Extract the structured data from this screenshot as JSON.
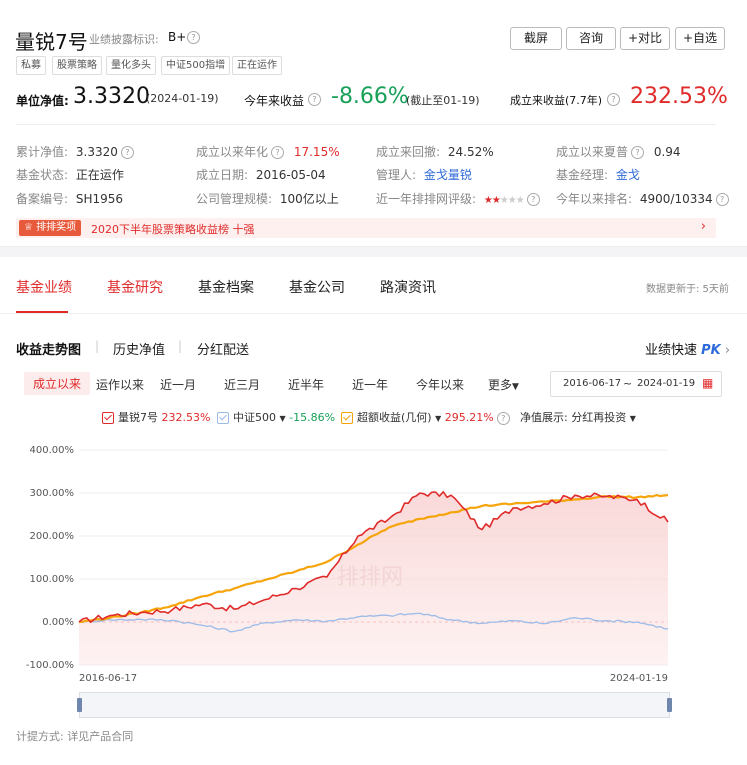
{
  "header": {
    "fund_name": "量锐7号",
    "disclosure_label": "业绩披露标识:",
    "disclosure_value": "B+",
    "tags": [
      "私募",
      "股票策略",
      "量化多头",
      "中证500指增",
      "正在运作"
    ],
    "buttons": [
      "截屏",
      "咨询",
      "+对比",
      "+自选"
    ]
  },
  "metrics": {
    "nav_label": "单位净值:",
    "nav_value": "3.3320",
    "nav_date": "(2024-01-19)",
    "ytd_label": "今年来收益",
    "ytd_value": "-8.66%",
    "ytd_note": "(截止至01-19)",
    "since_label": "成立来收益(7.7年)",
    "since_value": "232.53%"
  },
  "details": [
    {
      "label": "累计净值:",
      "value": "3.3320",
      "q": true
    },
    {
      "label": "成立以来年化",
      "value": "17.15%",
      "q": true
    },
    {
      "label": "成立来回撤:",
      "value": "24.52%"
    },
    {
      "label": "成立以来夏普",
      "value": "0.94",
      "q": true
    },
    {
      "label": "基金状态:",
      "value": "正在运作"
    },
    {
      "label": "成立日期:",
      "value": "2016-05-04"
    },
    {
      "label": "管理人:",
      "value": "金戈量锐"
    },
    {
      "label": "基金经理:",
      "value": "金戈"
    },
    {
      "label": "备案编号:",
      "value": "SH1956"
    },
    {
      "label": "公司管理规模:",
      "value": "100亿以上"
    },
    {
      "label": "近一年排排网评级:",
      "value": ""
    },
    {
      "label": "今年以来排名:",
      "value": "4900/10334",
      "q": true
    }
  ],
  "banner": {
    "badge": "排排奖项",
    "text": "2020下半年股票策略收益榜 十强"
  },
  "nav_tabs": [
    "基金业绩",
    "基金研究",
    "基金档案",
    "基金公司",
    "路演资讯"
  ],
  "update_note": "数据更新于:  5天前",
  "sub_tabs": [
    "收益走势图",
    "历史净值",
    "分红配送"
  ],
  "quick_perf": "业绩快速",
  "pk": "PK",
  "ranges": [
    "成立以来",
    "运作以来",
    "近一月",
    "近三月",
    "近半年",
    "近一年",
    "今年以来",
    "更多"
  ],
  "date_range": {
    "start": "2016-06-17",
    "sep": "~",
    "end": "2024-01-19"
  },
  "legend": {
    "fund": {
      "name": "量锐7号",
      "value": "232.53%",
      "color": "#e02b2b"
    },
    "index": {
      "name": "中证500",
      "value": "-15.86%",
      "color": "#9bbbe8"
    },
    "excess": {
      "name": "超额收益(几何)",
      "value": "295.21%",
      "color": "#f5a40a"
    },
    "display_label": "净值展示:",
    "display_value": "分红再投资"
  },
  "footer": {
    "label": "计提方式:",
    "value": "详见产品合同"
  },
  "watermark": "排排网",
  "chart_data": {
    "type": "line",
    "ylim": [
      -100,
      400
    ],
    "y_ticks": [
      "400.00%",
      "300.00%",
      "200.00%",
      "100.00%",
      "0.00%",
      "-100.00%"
    ],
    "x_tick_labels": [
      "2016-06-17",
      "2024-01-19"
    ],
    "x": [
      "2016-06",
      "2017-01",
      "2017-06",
      "2018-01",
      "2018-06",
      "2019-01",
      "2019-06",
      "2020-01",
      "2020-06",
      "2021-01",
      "2021-06",
      "2021-09",
      "2022-01",
      "2022-04",
      "2022-07",
      "2022-10",
      "2023-01",
      "2023-06",
      "2023-10",
      "2024-01"
    ],
    "series": [
      {
        "name": "量锐7号",
        "values": [
          0,
          15,
          22,
          28,
          42,
          30,
          52,
          78,
          105,
          200,
          240,
          300,
          295,
          215,
          265,
          275,
          295,
          292,
          285,
          232.53
        ]
      },
      {
        "name": "中证500",
        "values": [
          0,
          5,
          6,
          4,
          -8,
          -22,
          -2,
          5,
          2,
          12,
          15,
          20,
          5,
          -3,
          3,
          -4,
          10,
          3,
          0,
          -15.86
        ]
      },
      {
        "name": "超额收益(几何)",
        "values": [
          0,
          10,
          22,
          38,
          60,
          78,
          98,
          118,
          140,
          180,
          220,
          240,
          255,
          270,
          275,
          280,
          285,
          292,
          290,
          295.21
        ]
      }
    ]
  }
}
